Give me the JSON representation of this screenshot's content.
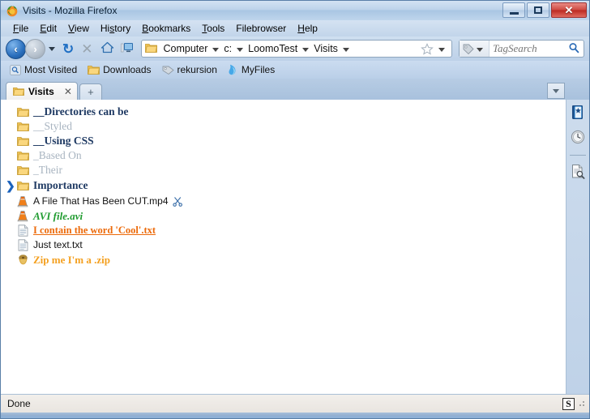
{
  "window": {
    "title": "Visits - Mozilla Firefox",
    "title_icon": "firefox-icon",
    "controls": {
      "minimize": "–",
      "maximize": "□",
      "close": "✕"
    }
  },
  "menubar": {
    "items": [
      {
        "label": "File",
        "accel": "F"
      },
      {
        "label": "Edit",
        "accel": "E"
      },
      {
        "label": "View",
        "accel": "V"
      },
      {
        "label": "History",
        "accel": "s"
      },
      {
        "label": "Bookmarks",
        "accel": "B"
      },
      {
        "label": "Tools",
        "accel": "T"
      },
      {
        "label": "Filebrowser",
        "accel": ""
      },
      {
        "label": "Help",
        "accel": "H"
      }
    ]
  },
  "navbar": {
    "back": "‹",
    "forward": "›",
    "reload": "↻",
    "stop": "✕",
    "home": "home-icon",
    "desktop": "desktop-icon",
    "breadcrumbs": [
      "Computer",
      "c:",
      "LoomoTest",
      "Visits"
    ],
    "star": "☆"
  },
  "search": {
    "placeholder": "TagSearch",
    "value": "",
    "engine_icon": "tag-icon",
    "go_icon": "magnifier-icon"
  },
  "bookmarks_toolbar": {
    "items": [
      {
        "label": "Most Visited",
        "icon": "most-visited-icon"
      },
      {
        "label": "Downloads",
        "icon": "folder-icon"
      },
      {
        "label": "rekursion",
        "icon": "tag-icon"
      },
      {
        "label": "MyFiles",
        "icon": "myfiles-icon"
      }
    ]
  },
  "tabs": {
    "items": [
      {
        "label": "Visits",
        "icon": "folder-icon",
        "close": "✕",
        "active": true
      }
    ],
    "new_tab": "+",
    "list_all": "list-all-tabs"
  },
  "filelist": {
    "rows": [
      {
        "name": "__Directories can be",
        "icon": "folder-icon",
        "style": "st-dirbold",
        "chevron": false,
        "trail": ""
      },
      {
        "name": "__Styled",
        "icon": "folder-icon",
        "style": "st-dimmed",
        "chevron": false,
        "trail": ""
      },
      {
        "name": "__Using CSS",
        "icon": "folder-icon",
        "style": "st-dirbold",
        "chevron": false,
        "trail": ""
      },
      {
        "name": "_Based On",
        "icon": "folder-icon",
        "style": "st-dimmed",
        "chevron": false,
        "trail": ""
      },
      {
        "name": "_Their",
        "icon": "folder-icon",
        "style": "st-dimmed",
        "chevron": false,
        "trail": ""
      },
      {
        "name": "Importance",
        "icon": "folder-icon",
        "style": "st-dirbold",
        "chevron": true,
        "trail": ""
      },
      {
        "name": "A File That Has Been CUT.mp4",
        "icon": "vlc-icon",
        "style": "st-plain",
        "chevron": false,
        "trail": "scissors-icon"
      },
      {
        "name": "AVI file.avi",
        "icon": "vlc-icon",
        "style": "st-green",
        "chevron": false,
        "trail": ""
      },
      {
        "name": "I contain the word 'Cool'.txt",
        "icon": "text-file-icon",
        "style": "st-orange-u",
        "chevron": false,
        "trail": ""
      },
      {
        "name": "Just text.txt",
        "icon": "text-file-icon",
        "style": "st-plain",
        "chevron": false,
        "trail": ""
      },
      {
        "name": "Zip me I'm a .zip",
        "icon": "zip-icon",
        "style": "st-orange",
        "chevron": false,
        "trail": ""
      }
    ]
  },
  "sidebar": {
    "buttons": [
      {
        "name": "bookmarks-sidebar-button",
        "icon": "bookmarks-book-icon"
      },
      {
        "name": "history-sidebar-button",
        "icon": "clock-icon"
      },
      {
        "name": "find-sidebar-button",
        "icon": "document-search-icon"
      }
    ]
  },
  "statusbar": {
    "text": "Done",
    "noscript_label": "S"
  },
  "colors": {
    "accent_blue": "#1a62bd",
    "dir_bold": "#1f3a63",
    "dimmed": "#a8b4c0",
    "green": "#1f9b2f",
    "orange_link": "#ec6a0a",
    "orange_zip": "#f4a020",
    "chrome_blue": "#a9c6e3"
  }
}
